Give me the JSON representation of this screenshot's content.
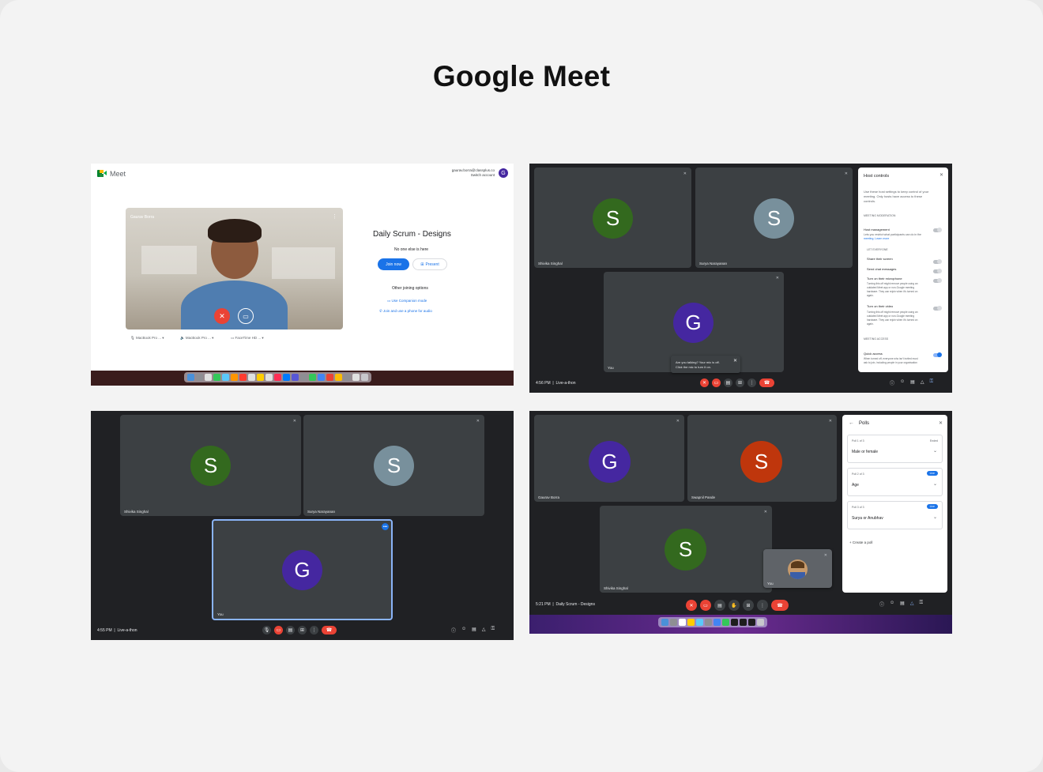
{
  "page": {
    "title": "Google Meet"
  },
  "lobby": {
    "logo_text": "Meet",
    "account_email": "gaurav.borra@classplus.co",
    "switch_account": "Switch account",
    "account_initial": "G",
    "self_name": "Gaurav Borra",
    "meeting_title": "Daily Scrum - Designs",
    "status": "No one else is here",
    "join_now": "Join now",
    "present": "Present",
    "other_options": "Other joining options",
    "companion": "Use Companion mode",
    "phone_audio": "Join and use a phone for audio",
    "devices": [
      "MacBook Pro ...",
      "MacBook Pro ...",
      "FaceTime HD ..."
    ]
  },
  "host_screen": {
    "participants": [
      {
        "initial": "S",
        "name": "Shivika Singhal",
        "color": "#33691e"
      },
      {
        "initial": "S",
        "name": "Surya Narayanan",
        "color": "#78909c"
      },
      {
        "initial": "G",
        "name": "You",
        "color": "#4527a0"
      }
    ],
    "toast": [
      "Are you talking? Your mic is off.",
      "Click the mic to turn it on."
    ],
    "time": "4:56 PM",
    "meeting": "Live-a-thon",
    "panel": {
      "title": "Host controls",
      "intro": [
        "Use these host settings to keep control of your",
        "meeting. Only hosts have access to these",
        "controls."
      ],
      "section_moderation": "MEETING MODERATION",
      "host_mgmt": "Host management",
      "host_mgmt_desc": [
        "Lets you restrict what participants can do in the",
        "meeting. Learn more"
      ],
      "section_everyone": "LET EVERYONE",
      "share_screen": "Share their screen",
      "send_chat": "Send chat messages",
      "turn_mic": "Turn on their microphone",
      "mic_desc": [
        "Turning this off might remove people using an",
        "outdated Meet app or non-Google meeting",
        "hardware. They can rejoin when it's turned on",
        "again."
      ],
      "turn_video": "Turn on their video",
      "video_desc": [
        "Turning this off might remove people using an",
        "outdated Meet app or non-Google meeting",
        "hardware. They can rejoin when it's turned on",
        "again."
      ],
      "section_access": "MEETING ACCESS",
      "quick_access": "Quick access",
      "quick_desc": [
        "When turned off, everyone who isn't invited must",
        "ask to join, including people in your organisation"
      ]
    }
  },
  "call_screen": {
    "participants": [
      {
        "initial": "S",
        "name": "Shivika Singhal",
        "color": "#33691e"
      },
      {
        "initial": "S",
        "name": "Surya Narayanan",
        "color": "#78909c"
      },
      {
        "initial": "G",
        "name": "You",
        "color": "#4527a0"
      }
    ],
    "time": "4:55 PM",
    "meeting": "Live-a-thon"
  },
  "polls_screen": {
    "participants": [
      {
        "initial": "G",
        "name": "Gaurav Borra",
        "color": "#4527a0"
      },
      {
        "initial": "S",
        "name": "Swapnil Pande",
        "color": "#bf360c"
      },
      {
        "initial": "S",
        "name": "Shivika Singhal",
        "color": "#33691e"
      }
    ],
    "self_name": "You",
    "time": "5:21 PM",
    "meeting": "Daily Scrum - Designs",
    "panel": {
      "title": "Polls",
      "polls": [
        {
          "index": "Poll 1 of 3",
          "status": "Ended",
          "question": "Male or female"
        },
        {
          "index": "Poll 2 of 3",
          "status": "Live",
          "question": "Age"
        },
        {
          "index": "Poll 3 of 3",
          "status": "Live",
          "question": "Surya or Anubhav"
        }
      ],
      "create": "Create a poll"
    }
  }
}
